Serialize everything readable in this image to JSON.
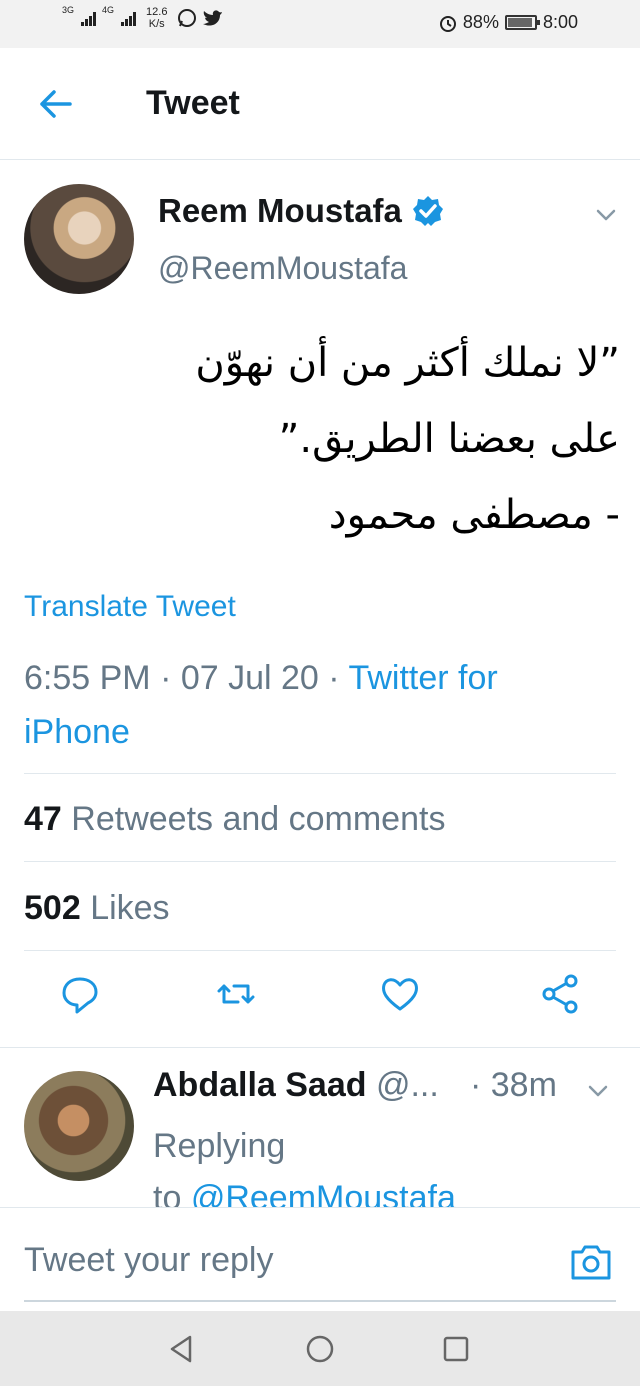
{
  "status_bar": {
    "network_left": "3G",
    "network_right": "4G",
    "speed_value": "12.6",
    "speed_unit": "K/s",
    "battery_percent": "88%",
    "time": "8:00"
  },
  "header": {
    "title": "Tweet",
    "back_icon": "arrow-left-icon"
  },
  "tweet": {
    "author_name": "Reem Moustafa",
    "author_handle": "@ReemMoustafa",
    "verified": true,
    "text": "”لا نملك أكثر من أن نهوّن\nعلى بعضنا الطريق.”\n- مصطفى محمود",
    "translate_label": "Translate Tweet",
    "timestamp": "6:55 PM · 07 Jul 20 · ",
    "source": "Twitter for iPhone",
    "retweets_count": "47",
    "retweets_label": "Retweets and comments",
    "likes_count": "502",
    "likes_label": "Likes"
  },
  "actions": [
    "reply-icon",
    "retweet-icon",
    "like-icon",
    "share-icon"
  ],
  "reply": {
    "author_name": "Abdalla Saad",
    "author_handle": "@...",
    "time": "· 38m",
    "replying_prefix": "Replying",
    "replying_to": "to ",
    "mention": "@ReemMoustafa"
  },
  "composer": {
    "placeholder": "Tweet your reply"
  },
  "colors": {
    "accent": "#1b95e0",
    "secondary_text": "#657786",
    "primary_text": "#14171a"
  }
}
